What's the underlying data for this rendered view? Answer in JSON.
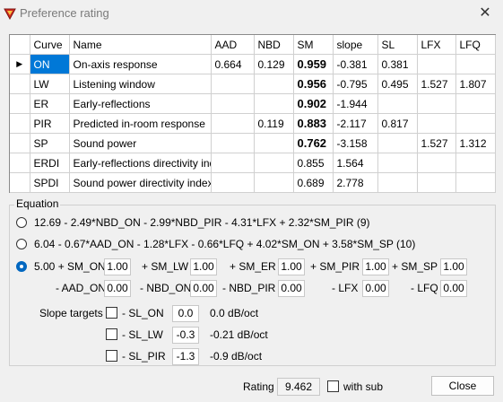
{
  "window": {
    "title": "Preference rating"
  },
  "table": {
    "columns": [
      "",
      "Curve",
      "Name",
      "AAD",
      "NBD",
      "SM",
      "slope",
      "SL",
      "LFX",
      "LFQ"
    ],
    "rows": [
      {
        "marker": "▶",
        "curve": "ON",
        "name": "On-axis response",
        "aad": "0.664",
        "nbd": "0.129",
        "sm": "0.959",
        "slope": "-0.381",
        "sl": "0.381",
        "lfx": "",
        "lfq": ""
      },
      {
        "marker": "",
        "curve": "LW",
        "name": "Listening window",
        "aad": "",
        "nbd": "",
        "sm": "0.956",
        "slope": "-0.795",
        "sl": "0.495",
        "lfx": "1.527",
        "lfq": "1.807"
      },
      {
        "marker": "",
        "curve": "ER",
        "name": "Early-reflections",
        "aad": "",
        "nbd": "",
        "sm": "0.902",
        "slope": "-1.944",
        "sl": "",
        "lfx": "",
        "lfq": ""
      },
      {
        "marker": "",
        "curve": "PIR",
        "name": "Predicted in-room response",
        "aad": "",
        "nbd": "0.119",
        "sm": "0.883",
        "slope": "-2.117",
        "sl": "0.817",
        "lfx": "",
        "lfq": ""
      },
      {
        "marker": "",
        "curve": "SP",
        "name": "Sound power",
        "aad": "",
        "nbd": "",
        "sm": "0.762",
        "slope": "-3.158",
        "sl": "",
        "lfx": "1.527",
        "lfq": "1.312"
      },
      {
        "marker": "",
        "curve": "ERDI",
        "name": "Early-reflections directivity index",
        "aad": "",
        "nbd": "",
        "sm": "0.855",
        "slope": "1.564",
        "sl": "",
        "lfx": "",
        "lfq": ""
      },
      {
        "marker": "",
        "curve": "SPDI",
        "name": "Sound power directivity index",
        "aad": "",
        "nbd": "",
        "sm": "0.689",
        "slope": "2.778",
        "sl": "",
        "lfx": "",
        "lfq": ""
      }
    ]
  },
  "equation": {
    "label": "Equation",
    "option1": "12.69 - 2.49*NBD_ON - 2.99*NBD_PIR - 4.31*LFX + 2.32*SM_PIR (9)",
    "option2": "6.04 - 0.67*AAD_ON - 1.28*LFX - 0.66*LFQ + 4.02*SM_ON + 3.58*SM_SP (10)",
    "custom": {
      "prefix": "5.00 + SM_ON",
      "sm_on": "1.00",
      "sm_lw_label": "+ SM_LW",
      "sm_lw": "1.00",
      "sm_er_label": "+ SM_ER",
      "sm_er": "1.00",
      "sm_pir_label": "+ SM_PIR",
      "sm_pir": "1.00",
      "sm_sp_label": "+ SM_SP",
      "sm_sp": "1.00",
      "aad_on_label": "- AAD_ON",
      "aad_on": "0.00",
      "nbd_on_label": "- NBD_ON",
      "nbd_on": "0.00",
      "nbd_pir_label": "- NBD_PIR",
      "nbd_pir": "0.00",
      "lfx_label": "- LFX",
      "lfx": "0.00",
      "lfq_label": "- LFQ",
      "lfq": "0.00"
    },
    "slope_targets": {
      "label": "Slope targets",
      "on": {
        "label": "- SL_ON",
        "value": "0.0",
        "unit": "0.0 dB/oct"
      },
      "lw": {
        "label": "- SL_LW",
        "value": "-0.3",
        "unit": "-0.21 dB/oct"
      },
      "pir": {
        "label": "- SL_PIR",
        "value": "-1.3",
        "unit": "-0.9 dB/oct"
      }
    }
  },
  "footer": {
    "rating_label": "Rating",
    "rating_value": "9.462",
    "with_sub": "with sub",
    "close": "Close"
  }
}
